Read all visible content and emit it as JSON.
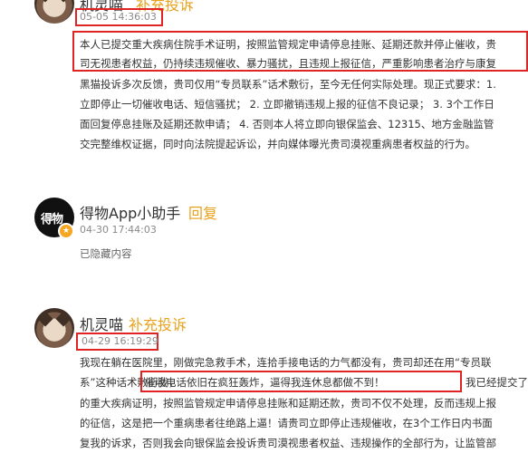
{
  "comment1": {
    "name": "机灵喵",
    "tag": "补充投诉",
    "time": "05-05 14:36:03",
    "lines": [
      "本人已提交重大疾病住院手术证明，按照监管规定申请停息挂账、延期还款并停止催收，贵",
      "司无视患者权益，仍持续违规催收、暴力骚扰，且违规上报征信，严重影响患者治疗与康复",
      "黑猫投诉多次反馈，贵司仅用“专员联系”话术敷衍，至今无任何实际处理。现正式要求：1.",
      "立即停止一切催收电话、短信骚扰； 2. 立即撤销违规上报的征信不良记录； 3. 3个工作日",
      "面回复停息挂账及延期还款申请； 4. 否则本人将立即向银保监会、12315、地方金融监管",
      "交完整维权证据，同时向法院提起诉讼，并向媒体曝光贵司漠视重病患者权益的行为。"
    ]
  },
  "reply": {
    "name": "得物App小助手",
    "tag": "回复",
    "time": "04-30 17:44:03",
    "text": "已隐藏内容",
    "logo": "得物",
    "badge": "★"
  },
  "comment2": {
    "name": "机灵喵",
    "tag": "补充投诉",
    "time": "04-29 16:19:29",
    "lines": [
      "我现在躺在医院里，刚做完急救手术，连拾手接电话的力气都没有，贵司却还在用“专员联",
      "系”这种话术敷衍我，",
      "的重大疾病证明，按照监管规定申请停息挂账和延期还款，贵司不仅不处理，反而违规上报",
      "的征信，这是把一个重病患者往绝路上逼！请贵司立即停止违规催收，在3个工作日内书面",
      "复我的诉求，否则我会向银保监会投诉贵司漠视患者权益、违规操作的全部行为，让监管部"
    ],
    "highlight": "催收电话依旧在疯狂轰炸，逼得我连休息都做不到！",
    "after_highlight": "我已经提交了"
  },
  "colors": {
    "accent_tag": "#e8a21b",
    "highlight_border": "#e02424"
  }
}
